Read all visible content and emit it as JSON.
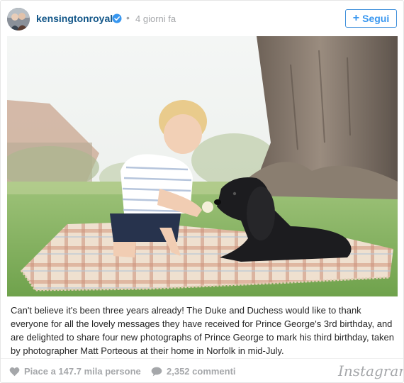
{
  "header": {
    "username": "kensingtonroyal",
    "separator": "•",
    "timestamp": "4 giorni fa",
    "follow_label": "Segui",
    "follow_icon": "plus-icon",
    "verified_icon": "verified-badge-icon",
    "avatar_icon": "avatar-photo"
  },
  "post": {
    "caption": "Can't believe it's been three years already! The Duke and Duchess would like to thank everyone for all the lovely messages they have received for Prince George's 3rd birthday, and are delighted to share four new photographs of Prince George to mark his third birthday, taken by photographer Matt Porteous at their home in Norfolk in mid-July."
  },
  "footer": {
    "likes_label": "Piace a 147.7 mila persone",
    "likes_icon": "heart-icon",
    "comments_label": "2,352 commenti",
    "comments_icon": "speech-bubble-icon",
    "brand": "Instagram"
  },
  "colors": {
    "username": "#125688",
    "accent": "#3897f0",
    "muted": "#a5a7aa",
    "text": "#262626"
  }
}
